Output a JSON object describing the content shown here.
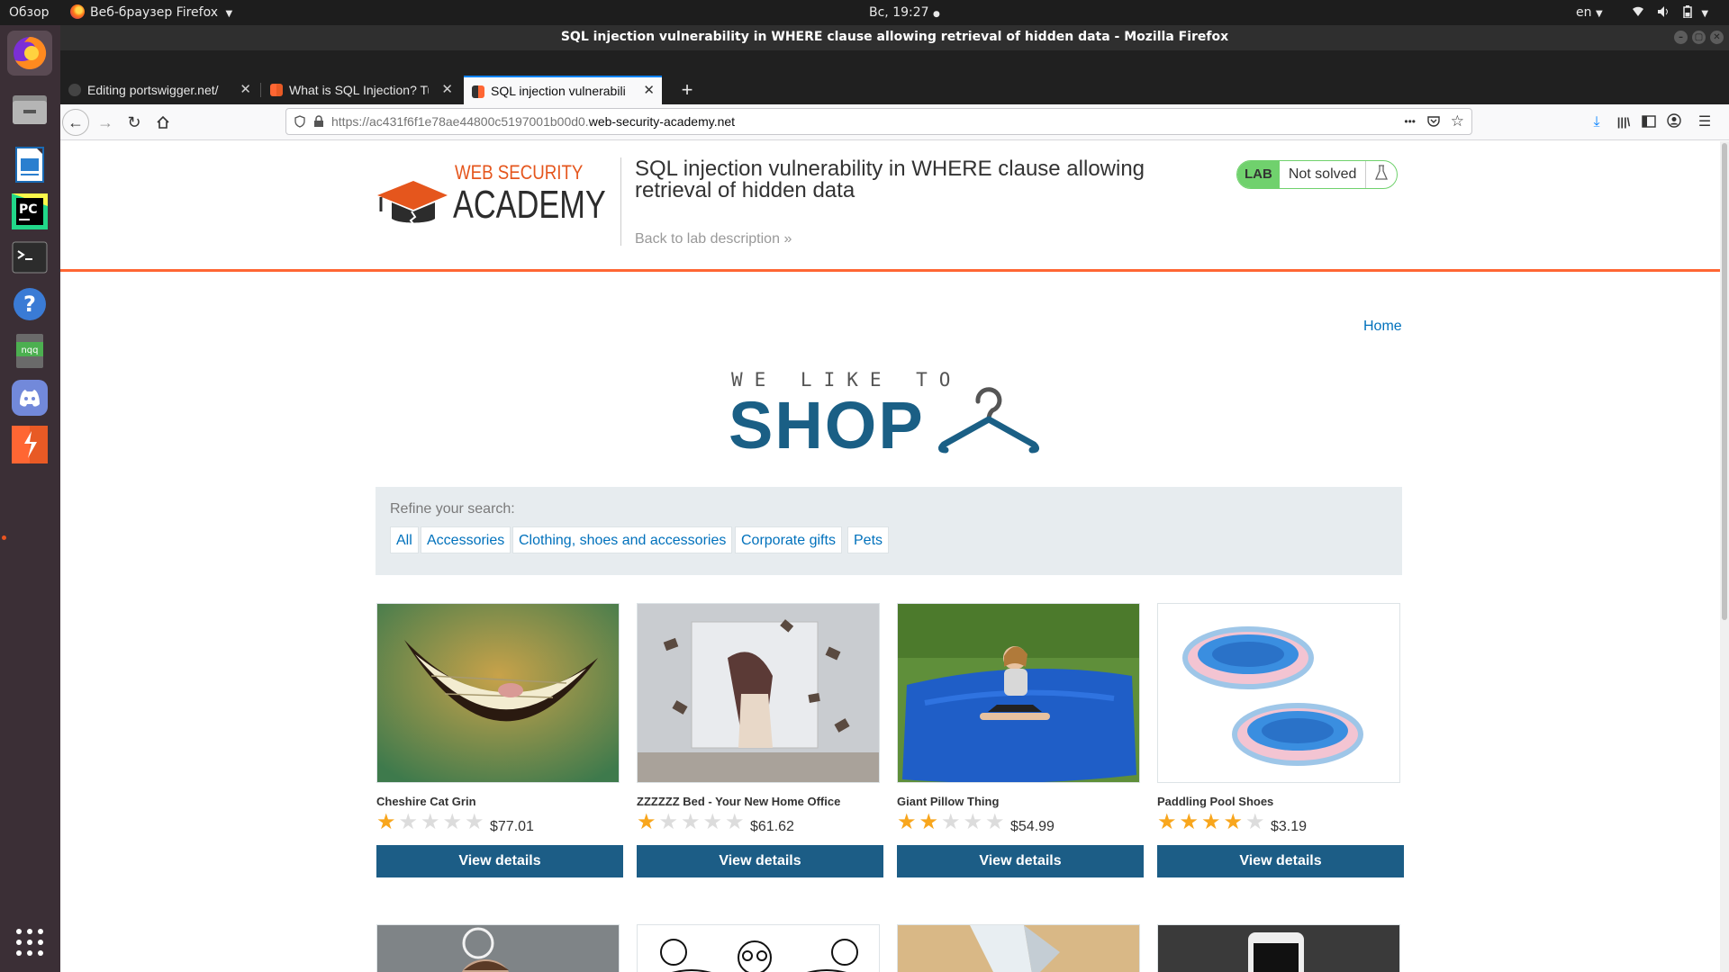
{
  "system_bar": {
    "overview": "Обзор",
    "app_menu": "Веб-браузер Firefox",
    "clock": "Вс, 19:27",
    "language": "en"
  },
  "window": {
    "title": "SQL injection vulnerability in WHERE clause allowing retrieval of hidden data - Mozilla Firefox"
  },
  "tabs": [
    {
      "label": "Editing portswigger.net/",
      "favicon": "github-icon"
    },
    {
      "label": "What is SQL Injection? Tu",
      "favicon": "portswigger-icon"
    },
    {
      "label": "SQL injection vulnerabili",
      "favicon": "portswigger-icon",
      "active": true
    }
  ],
  "urlbar": {
    "prefix": "https://ac431f6f1e78ae44800c5197001b00d0.",
    "domain": "web-security-academy.net",
    "more": "•••"
  },
  "academy": {
    "logo_top": "WEB SECURITY",
    "logo_bottom": "ACADEMY",
    "lab_title": "SQL injection vulnerability in WHERE clause allowing retrieval of hidden data",
    "back_link": "Back to lab description",
    "back_chevron": "»",
    "lab_tag": "LAB",
    "lab_status": "Not solved"
  },
  "nav": {
    "home": "Home"
  },
  "shop_logo": {
    "tagline": "WE LIKE TO",
    "word": "SHOP"
  },
  "refine": {
    "label": "Refine your search:",
    "filters": [
      "All",
      "Accessories",
      "Clothing, shoes and accessories",
      "Corporate gifts",
      "Pets"
    ]
  },
  "products": [
    {
      "name": "Cheshire Cat Grin",
      "rating": 1,
      "price": "$77.01",
      "button": "View details"
    },
    {
      "name": "ZZZZZZ Bed - Your New Home Office",
      "rating": 1,
      "price": "$61.62",
      "button": "View details"
    },
    {
      "name": "Giant Pillow Thing",
      "rating": 2,
      "price": "$54.99",
      "button": "View details"
    },
    {
      "name": "Paddling Pool Shoes",
      "rating": 4,
      "price": "$3.19",
      "button": "View details"
    }
  ],
  "colors": {
    "accent_orange": "#ff6633",
    "link_blue": "#0071bc",
    "button_blue": "#1c5d86",
    "shop_blue": "#1a5f85",
    "star_gold": "#f8a61d",
    "lab_green": "#70d16d"
  }
}
